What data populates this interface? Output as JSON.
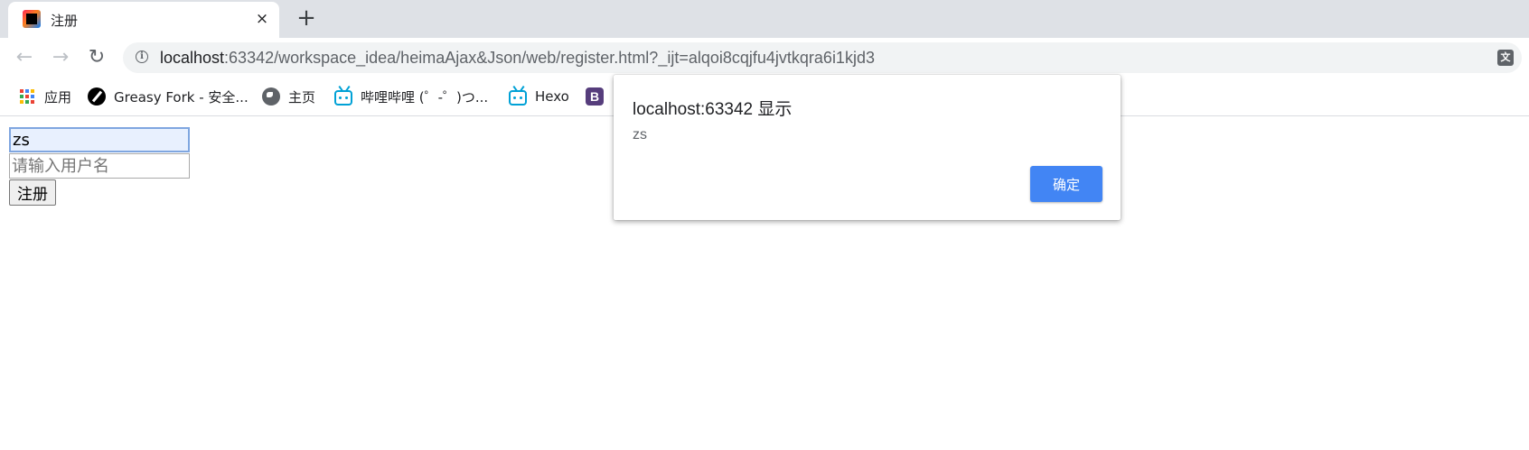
{
  "tab": {
    "title": "注册",
    "icon": "intellij-favicon",
    "close_icon": "×",
    "new_tab_icon": "+"
  },
  "toolbar": {
    "back_icon": "←",
    "forward_icon": "→",
    "reload_icon": "↻",
    "url_host": "localhost",
    "url_rest": ":63342/workspace_idea/heimaAjax&Json/web/register.html?_ijt=alqoi8cqjfu4jvtkqra6i1kjd3",
    "info_icon": "i",
    "translate_icon": "文"
  },
  "bookmarks": [
    {
      "label": "应用",
      "icon": "apps-grid-icon"
    },
    {
      "label": "Greasy Fork - 安全...",
      "icon": "greasy-fork-icon"
    },
    {
      "label": "主页",
      "icon": "globe-icon"
    },
    {
      "label": "哔哩哔哩 (゜-゜)つ...",
      "icon": "bilibili-icon"
    },
    {
      "label": "Hexo",
      "icon": "bilibili-icon"
    },
    {
      "label": "B",
      "icon": "bootstrap-icon"
    }
  ],
  "apps_colors": [
    "#ea4335",
    "#4285f4",
    "#fbbc05",
    "#34a853",
    "#ea4335",
    "#4285f4",
    "#fbbc05",
    "#34a853",
    "#ea4335"
  ],
  "form": {
    "username_value": "zs",
    "username_placeholder": "请输入用户名",
    "submit_label": "注册"
  },
  "dialog": {
    "title": "localhost:63342 显示",
    "message": "zs",
    "ok_label": "确定"
  },
  "colors": {
    "accent": "#4285f4",
    "tabstrip": "#dee1e6",
    "omnibox": "#f1f3f4"
  }
}
